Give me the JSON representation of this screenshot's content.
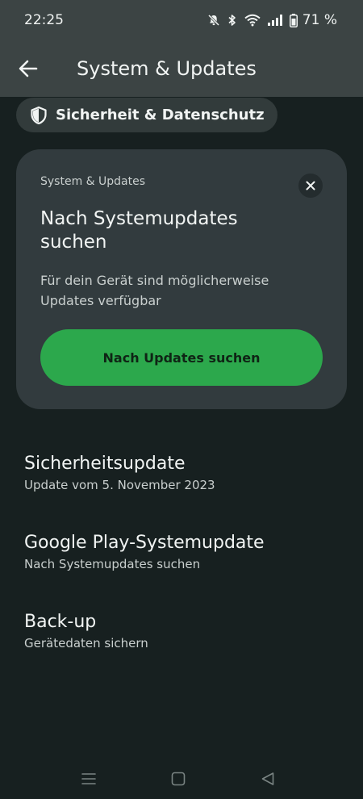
{
  "status": {
    "time": "22:25",
    "battery": "71 %"
  },
  "appbar": {
    "title": "System & Updates"
  },
  "chip": {
    "label": "Sicherheit & Datenschutz"
  },
  "card": {
    "kicker": "System & Updates",
    "heading": "Nach Systemupdates suchen",
    "description": "Für dein Gerät sind möglicherweise Updates verfügbar",
    "button": "Nach Updates suchen"
  },
  "items": [
    {
      "title": "Sicherheitsupdate",
      "subtitle": "Update vom 5. November 2023"
    },
    {
      "title": "Google Play-Systemupdate",
      "subtitle": "Nach Systemupdates suchen"
    },
    {
      "title": "Back-up",
      "subtitle": "Gerätedaten sichern"
    }
  ],
  "colors": {
    "accent": "#2ca84c",
    "background": "#172020",
    "bar": "#3c4444",
    "card": "#323b3e"
  }
}
